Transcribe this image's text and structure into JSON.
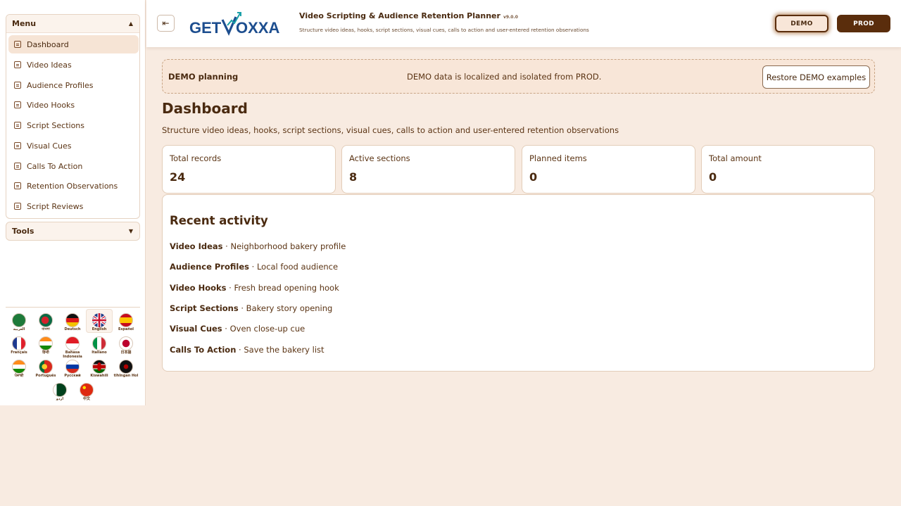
{
  "sidebar": {
    "menu_title": "Menu",
    "tools_title": "Tools",
    "items": [
      {
        "label": "Dashboard"
      },
      {
        "label": "Video Ideas"
      },
      {
        "label": "Audience Profiles"
      },
      {
        "label": "Video Hooks"
      },
      {
        "label": "Script Sections"
      },
      {
        "label": "Visual Cues"
      },
      {
        "label": "Calls To Action"
      },
      {
        "label": "Retention Observations"
      },
      {
        "label": "Script Reviews"
      }
    ],
    "languages": [
      {
        "label": "العربية"
      },
      {
        "label": "বাংলা"
      },
      {
        "label": "Deutsch"
      },
      {
        "label": "English"
      },
      {
        "label": "Español"
      },
      {
        "label": "Français"
      },
      {
        "label": "हिन्दी"
      },
      {
        "label": "Bahasa Indonesia"
      },
      {
        "label": "Italiano"
      },
      {
        "label": "日本語"
      },
      {
        "label": "ਪੰਜਾਬੀ"
      },
      {
        "label": "Português"
      },
      {
        "label": "Русский"
      },
      {
        "label": "Kiswahili"
      },
      {
        "label": "tlhIngan Hol"
      },
      {
        "label": "اردو"
      },
      {
        "label": "中文"
      }
    ]
  },
  "header": {
    "logo_text_left": "GET",
    "logo_text_right": "OXXA",
    "title": "Video Scripting & Audience Retention Planner",
    "version": "v9.0.0",
    "subtitle": "Structure video ideas, hooks, script sections, visual cues, calls to action and user-entered retention observations",
    "demo_label": "DEMO",
    "prod_label": "PROD"
  },
  "banner": {
    "title": "DEMO planning",
    "text": "DEMO data is localized and isolated from PROD.",
    "restore_label": "Restore DEMO examples"
  },
  "main": {
    "title": "Dashboard",
    "description": "Structure video ideas, hooks, script sections, visual cues, calls to action and user-entered retention observations",
    "stats": [
      {
        "label": "Total records",
        "value": "24"
      },
      {
        "label": "Active sections",
        "value": "8"
      },
      {
        "label": "Planned items",
        "value": "0"
      },
      {
        "label": "Total amount",
        "value": "0"
      }
    ],
    "activity_title": "Recent activity",
    "activity": [
      {
        "type": "Video Ideas",
        "text": " · Neighborhood bakery profile"
      },
      {
        "type": "Audience Profiles",
        "text": " · Local food audience"
      },
      {
        "type": "Video Hooks",
        "text": " · Fresh bread opening hook"
      },
      {
        "type": "Script Sections",
        "text": " · Bakery story opening"
      },
      {
        "type": "Visual Cues",
        "text": " · Oven close-up cue"
      },
      {
        "type": "Calls To Action",
        "text": " · Save the bakery list"
      }
    ]
  },
  "colors": {
    "background": "#f8ebe1",
    "accent": "#5a2d0c",
    "text": "#4a2a10",
    "logo_blue": "#1d4e8f",
    "logo_teal": "#1aa0a8"
  }
}
